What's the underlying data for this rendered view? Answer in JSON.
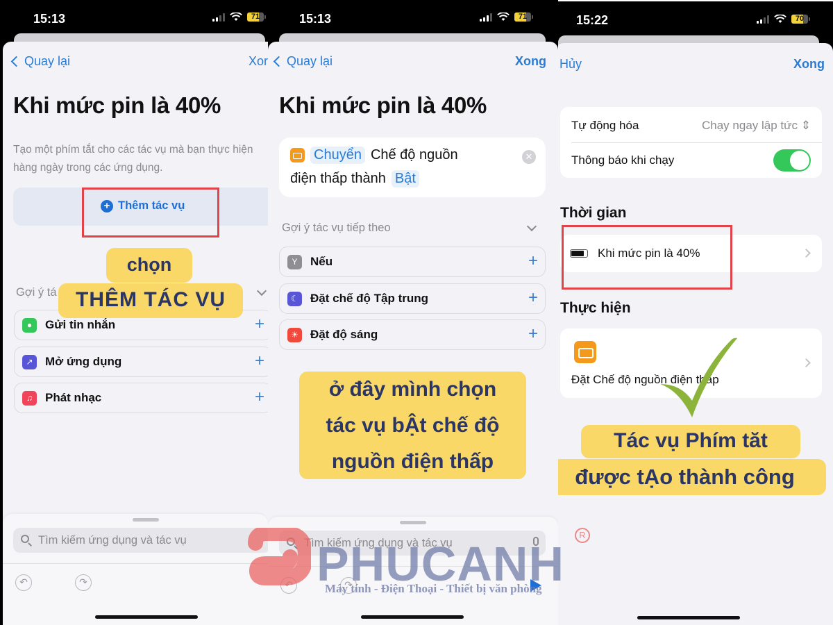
{
  "colors": {
    "accent": "#2a7bd3",
    "callout_bg": "#f9d867",
    "callout_text": "#2b3566",
    "highlight_box": "#e0444a",
    "toggle_on": "#34c759",
    "checkmark": "#8db43a"
  },
  "panels": [
    {
      "status": {
        "time": "15:13",
        "battery": "71",
        "battery_level": 0.71
      },
      "nav": {
        "back_label": "Quay lại",
        "done_label": "Xor"
      },
      "title": "Khi mức pin là 40%",
      "description": "Tạo một phím tắt cho các tác vụ mà bạn thực hiện hàng ngày trong các ứng dụng.",
      "add_action_label": "Thêm tác vụ",
      "suggestions_label": "Gợi ý tá",
      "suggestions": [
        {
          "label": "Gửi tin nhắn",
          "icon": "messages-icon",
          "color": "#34c759"
        },
        {
          "label": "Mở ứng dụng",
          "icon": "open-app-icon",
          "color": "#5856d6"
        },
        {
          "label": "Phát nhạc",
          "icon": "music-icon",
          "color": "#ef4459"
        }
      ],
      "callout": {
        "line1": "chọn",
        "line2": "THÊM TÁC VỤ"
      },
      "search_placeholder": "Tìm kiếm ứng dụng và tác vụ"
    },
    {
      "status": {
        "time": "15:13",
        "battery": "71",
        "battery_level": 0.71
      },
      "nav": {
        "back_label": "Quay lại",
        "done_label": "Xong"
      },
      "title": "Khi mức pin là 40%",
      "action": {
        "verb_token": "Chuyển",
        "text1": "Chế độ nguồn",
        "text2": "điện thấp thành",
        "value_token": "Bật"
      },
      "suggestions_label": "Gợi ý tác vụ tiếp theo",
      "suggestions": [
        {
          "label": "Nếu",
          "icon": "if-branch-icon",
          "color": "#8e8e93"
        },
        {
          "label": "Đặt chế độ Tập trung",
          "icon": "moon-icon",
          "color": "#5856d6"
        },
        {
          "label": "Đặt độ sáng",
          "icon": "brightness-icon",
          "color": "#ef4a3c"
        }
      ],
      "callout": {
        "line1": "ở đây mình chọn",
        "line2": "tác vụ bẬt chế độ",
        "line3": "nguồn điện thấp"
      },
      "search_placeholder": "Tìm kiếm ứng dụng và tác vụ"
    },
    {
      "status": {
        "time": "15:22",
        "battery": "70",
        "battery_level": 0.7
      },
      "nav": {
        "cancel_label": "Hủy",
        "done_label": "Xong"
      },
      "settings": {
        "automation_label": "Tự động hóa",
        "automation_value": "Chạy ngay lập tức",
        "notify_label": "Thông báo khi chạy",
        "notify_on": true
      },
      "time_section": {
        "title": "Thời gian",
        "trigger": "Khi mức pin là 40%"
      },
      "do_section": {
        "title": "Thực hiện",
        "action": "Đặt Chế độ nguồn điện thấp"
      },
      "callout": {
        "line1": "Tác vụ Phím tăt",
        "line2": "được tẠo thành công"
      }
    }
  ],
  "watermark": {
    "brand": "PHUCANH",
    "registered": "R",
    "tagline": "Máy tính - Điện Thoại - Thiết bị văn phòng"
  }
}
